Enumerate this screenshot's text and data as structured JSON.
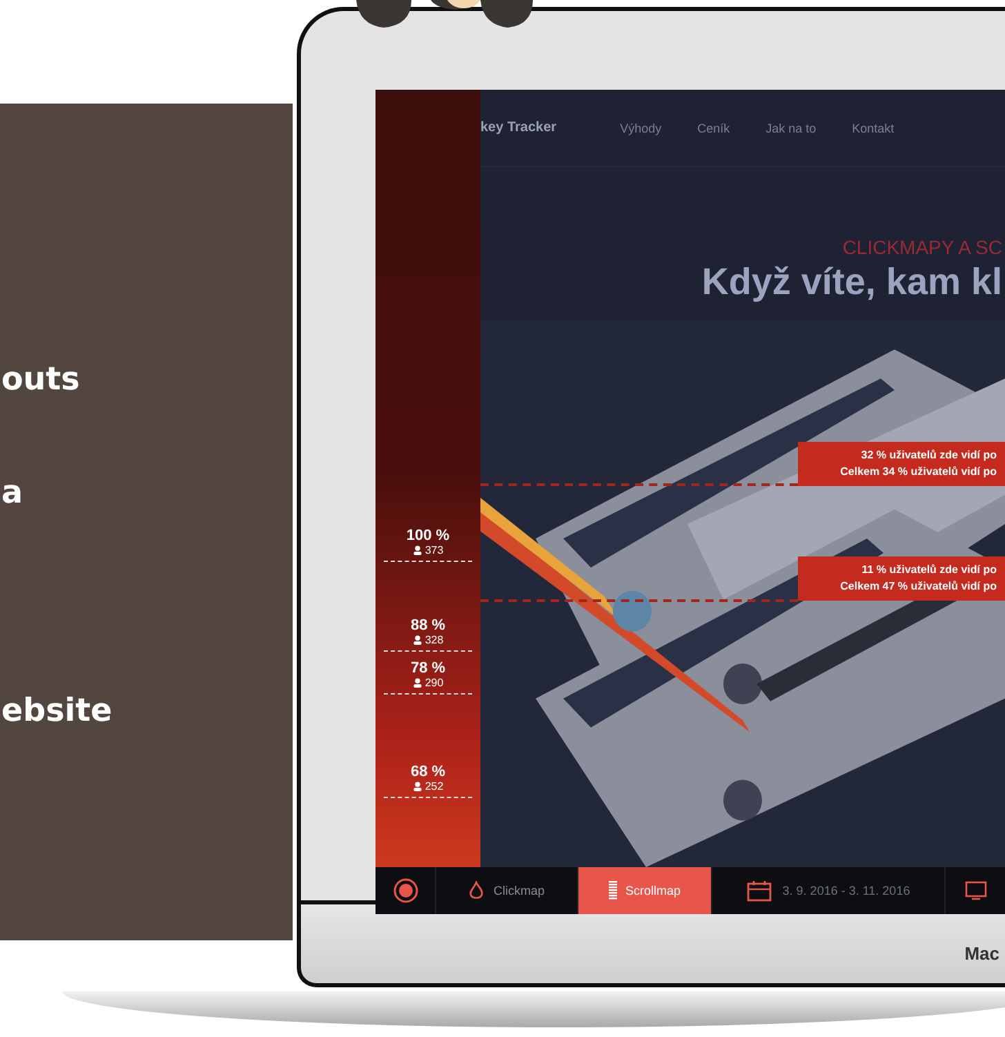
{
  "side_panel": {
    "lines": [
      "outs",
      "a",
      "ebsite"
    ]
  },
  "laptop": {
    "brand": "Mac",
    "screen": {
      "nav": {
        "logo": "key Tracker",
        "links": [
          "Výhody",
          "Ceník",
          "Jak na to",
          "Kontakt"
        ]
      },
      "hero": {
        "kicker": "CLICKMAPY A SC",
        "title": "Když víte, kam kl"
      },
      "scroll_markers": [
        {
          "percent": "100 %",
          "visitors": "373"
        },
        {
          "percent": "88 %",
          "visitors": "328"
        },
        {
          "percent": "78 %",
          "visitors": "290"
        },
        {
          "percent": "68 %",
          "visitors": "252"
        }
      ],
      "callouts": [
        {
          "line_1": "32 % uživatelů zde vidí po",
          "line_2": "Celkem 34 % uživatelů vidí po"
        },
        {
          "line_1": "11 % uživatelů zde vidí po",
          "line_2": "Celkem 47 % uživatelů vidí po"
        }
      ],
      "toolbar": {
        "tabs": [
          {
            "label": "Clickmap",
            "kind": "clickmap",
            "selected": false
          },
          {
            "label": "Scrollmap",
            "kind": "scrollmap",
            "selected": true
          }
        ],
        "date_range": "3. 9. 2016 - 3. 11. 2016"
      }
    }
  }
}
